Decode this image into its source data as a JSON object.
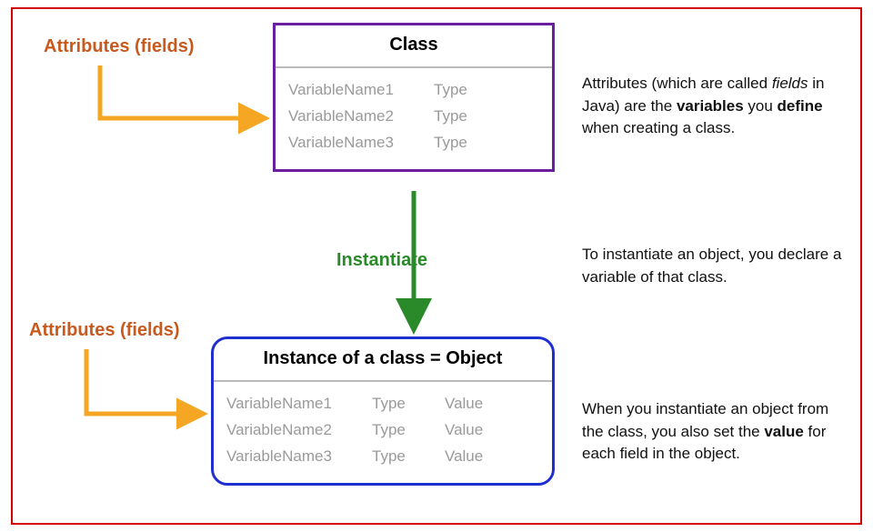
{
  "labels": {
    "attributes_top": "Attributes (fields)",
    "attributes_bottom": "Attributes (fields)",
    "class_title": "Class",
    "object_title": "Instance of a class = Object",
    "instantiate": "Instantiate"
  },
  "class_rows": [
    {
      "name": "VariableName1",
      "type": "Type"
    },
    {
      "name": "VariableName2",
      "type": "Type"
    },
    {
      "name": "VariableName3",
      "type": "Type"
    }
  ],
  "object_rows": [
    {
      "name": "VariableName1",
      "type": "Type",
      "value": "Value"
    },
    {
      "name": "VariableName2",
      "type": "Type",
      "value": "Value"
    },
    {
      "name": "VariableName3",
      "type": "Type",
      "value": "Value"
    }
  ],
  "explanations": {
    "top_pre": "Attributes (which are called ",
    "top_italic": "fields",
    "top_mid": " in Java) are the ",
    "top_bold1": "variables",
    "top_mid2": " you ",
    "top_bold2": "define",
    "top_post": " when creating a class.",
    "middle": "To instantiate an object, you declare a variable of that class.",
    "bottom_pre": "When you instantiate an object from the class, you also set the ",
    "bottom_bold": "value",
    "bottom_post": " for each field in the object."
  }
}
